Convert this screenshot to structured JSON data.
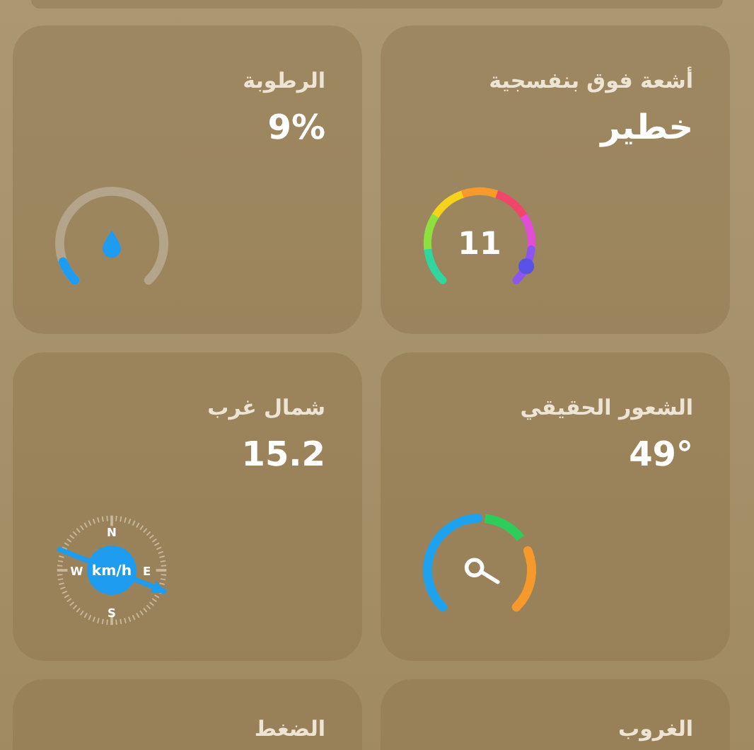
{
  "tiles": [
    {
      "kind": "uv",
      "title": "أشعة فوق بنفسجية",
      "value": "خطير",
      "gauge_text": "11"
    },
    {
      "kind": "humidity",
      "title": "الرطوبة",
      "value": "9%"
    },
    {
      "kind": "feels",
      "title": "الشعور الحقيقي",
      "value": "49°"
    },
    {
      "kind": "wind",
      "title": "شمال غرب",
      "value": "15.2",
      "unit": "km/h",
      "labels": [
        "N",
        "W",
        "E",
        "S"
      ]
    },
    {
      "kind": "plain",
      "title": "الغروب"
    },
    {
      "kind": "plain",
      "title": "الضغط"
    }
  ]
}
